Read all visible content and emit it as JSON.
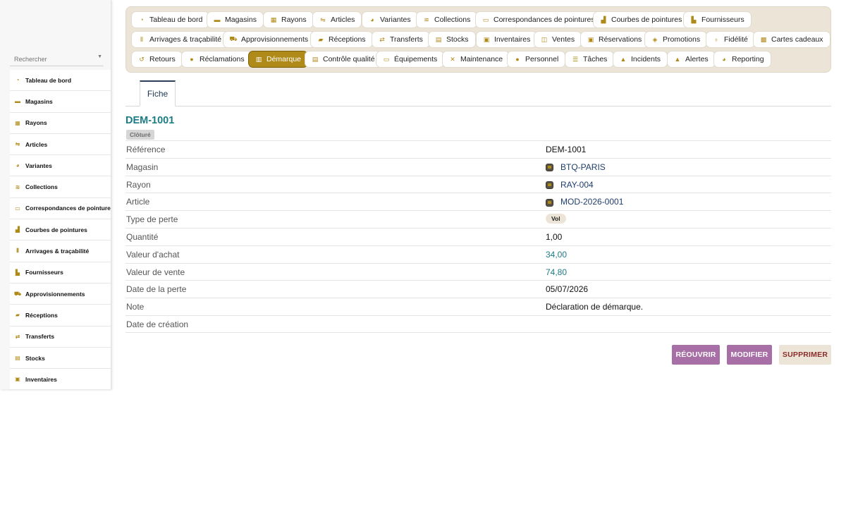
{
  "search": {
    "placeholder": "Rechercher"
  },
  "colors": {
    "accent": "#b08a18",
    "title": "#1b7c86",
    "link": "#1e3d6b",
    "action": "#a86ea6",
    "nav_bg": "#ece4d7"
  },
  "sidebar": {
    "items": [
      {
        "label": "Tableau de bord",
        "icon": "dashboard-icon"
      },
      {
        "label": "Magasins",
        "icon": "store-icon"
      },
      {
        "label": "Rayons",
        "icon": "grid-icon"
      },
      {
        "label": "Articles",
        "icon": "tag-icon"
      },
      {
        "label": "Variantes",
        "icon": "palette-icon"
      },
      {
        "label": "Collections",
        "icon": "layers-icon"
      },
      {
        "label": "Correspondances de pointures",
        "icon": "ruler-icon"
      },
      {
        "label": "Courbes de pointures",
        "icon": "chart-icon"
      },
      {
        "label": "Arrivages & traçabilité",
        "icon": "barcode-icon"
      },
      {
        "label": "Fournisseurs",
        "icon": "factory-icon"
      },
      {
        "label": "Approvisionnements",
        "icon": "cart-icon"
      },
      {
        "label": "Réceptions",
        "icon": "truck-icon"
      },
      {
        "label": "Transferts",
        "icon": "transfer-icon"
      },
      {
        "label": "Stocks",
        "icon": "box-icon"
      },
      {
        "label": "Inventaires",
        "icon": "clipboard-icon"
      }
    ]
  },
  "topnav": {
    "items": [
      {
        "label": "Tableau de bord",
        "icon": "dashboard-icon"
      },
      {
        "label": "Magasins",
        "icon": "store-icon"
      },
      {
        "label": "Rayons",
        "icon": "grid-icon"
      },
      {
        "label": "Articles",
        "icon": "tag-icon"
      },
      {
        "label": "Variantes",
        "icon": "palette-icon"
      },
      {
        "label": "Collections",
        "icon": "layers-icon"
      },
      {
        "label": "Correspondances de pointures",
        "icon": "ruler-icon"
      },
      {
        "label": "Courbes de pointures",
        "icon": "chart-icon"
      },
      {
        "label": "Fournisseurs",
        "icon": "factory-icon"
      },
      {
        "label": "Arrivages & traçabilité",
        "icon": "barcode-icon"
      },
      {
        "label": "Approvisionnements",
        "icon": "cart-icon"
      },
      {
        "label": "Réceptions",
        "icon": "truck-icon"
      },
      {
        "label": "Transferts",
        "icon": "transfer-icon"
      },
      {
        "label": "Stocks",
        "icon": "box-icon"
      },
      {
        "label": "Inventaires",
        "icon": "clipboard-icon"
      },
      {
        "label": "Ventes",
        "icon": "register-icon"
      },
      {
        "label": "Réservations",
        "icon": "calendar-check-icon"
      },
      {
        "label": "Promotions",
        "icon": "price-tag-icon"
      },
      {
        "label": "Fidélité",
        "icon": "medal-icon"
      },
      {
        "label": "Cartes cadeaux",
        "icon": "gift-icon"
      },
      {
        "label": "Retours",
        "icon": "undo-icon"
      },
      {
        "label": "Réclamations",
        "icon": "comment-icon"
      },
      {
        "label": "Démarque",
        "icon": "trash-icon",
        "active": true
      },
      {
        "label": "Contrôle qualité",
        "icon": "checklist-icon"
      },
      {
        "label": "Équipements",
        "icon": "monitor-icon"
      },
      {
        "label": "Maintenance",
        "icon": "tools-icon"
      },
      {
        "label": "Personnel",
        "icon": "users-icon"
      },
      {
        "label": "Tâches",
        "icon": "list-icon"
      },
      {
        "label": "Incidents",
        "icon": "warning-icon"
      },
      {
        "label": "Alertes",
        "icon": "bell-icon"
      },
      {
        "label": "Reporting",
        "icon": "pie-icon"
      }
    ]
  },
  "tabs": {
    "fiche": "Fiche"
  },
  "record": {
    "title": "DEM-1001",
    "status": "Clôturé",
    "fields": [
      {
        "label": "Référence",
        "value": "DEM-1001",
        "kind": "text"
      },
      {
        "label": "Magasin",
        "value": "BTQ-PARIS",
        "kind": "link"
      },
      {
        "label": "Rayon",
        "value": "RAY-004",
        "kind": "link"
      },
      {
        "label": "Article",
        "value": "MOD-2026-0001",
        "kind": "link"
      },
      {
        "label": "Type de perte",
        "value": "Vol",
        "kind": "pill"
      },
      {
        "label": "Quantité",
        "value": "1,00",
        "kind": "text"
      },
      {
        "label": "Valeur d'achat",
        "value": "34,00",
        "kind": "teal"
      },
      {
        "label": "Valeur de vente",
        "value": "74,80",
        "kind": "teal"
      },
      {
        "label": "Date de la perte",
        "value": "05/07/2026",
        "kind": "text"
      },
      {
        "label": "Note",
        "value": "Déclaration de démarque.",
        "kind": "text"
      },
      {
        "label": "Date de création",
        "value": "",
        "kind": "text"
      }
    ]
  },
  "actions": {
    "reopen": "RÉOUVRIR",
    "edit": "MODIFIER",
    "delete": "SUPPRIMER"
  }
}
